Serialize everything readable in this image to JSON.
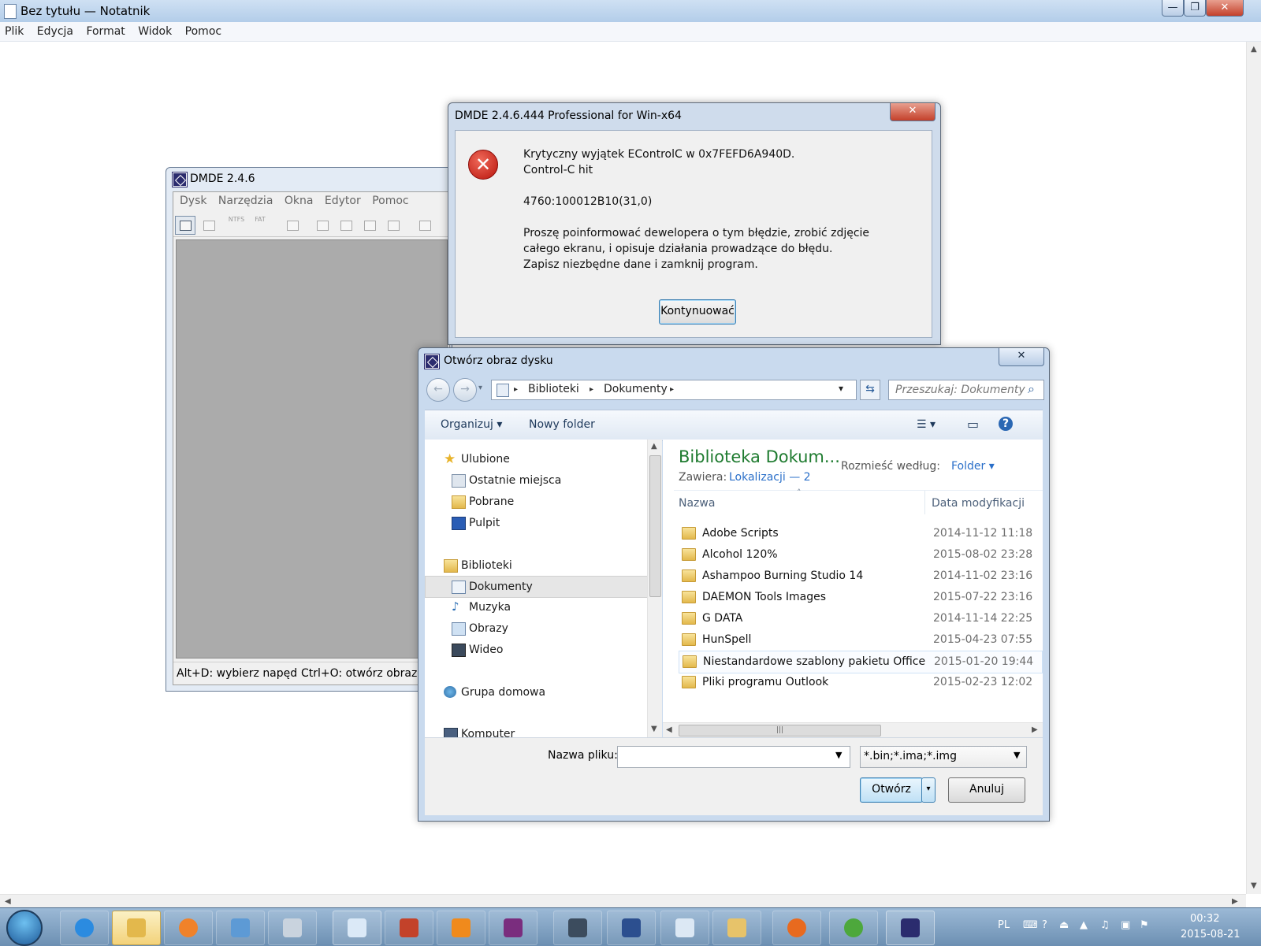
{
  "notepad": {
    "title": "Bez tytułu — Notatnik",
    "menu": [
      "Plik",
      "Edycja",
      "Format",
      "Widok",
      "Pomoc"
    ],
    "caption_buttons": {
      "minimize": "—",
      "maximize": "❐",
      "close": "✕"
    }
  },
  "dmde_main": {
    "title": "DMDE 2.4.6",
    "menu": [
      "Dysk",
      "Narzędzia",
      "Okna",
      "Edytor",
      "Pomoc"
    ],
    "toolbar_texts": {
      "ntfs": "NTFS",
      "fat": "FAT"
    },
    "status": {
      "left": "Alt+D: wybierz napęd",
      "right": "Ctrl+O: otwórz obraz"
    }
  },
  "error_dialog": {
    "title": "DMDE 2.4.6.444 Professional for Win-x64",
    "close": "✕",
    "icon": "✕",
    "lines": [
      "Krytyczny wyjątek EControlC w 0x7FEFD6A940D.",
      "Control-C hit",
      "4760:100012B10(31,0)",
      "Proszę poinformować dewelopera o tym błędzie, zrobić zdjęcie",
      "całego ekranu, i opisuje działania prowadzące do błędu.",
      "Zapisz niezbędne dane i zamknij program."
    ],
    "button": "Kontynuować"
  },
  "open_dialog": {
    "title": "Otwórz obraz dysku",
    "close": "✕",
    "nav": {
      "back": "←",
      "forward": "→",
      "dropdown": "▾"
    },
    "address": {
      "segments": [
        "Biblioteki",
        "Dokumenty"
      ],
      "separator": "▸",
      "dropdown": "▾",
      "refresh": "⇆"
    },
    "search": {
      "placeholder": "Przeszukaj: Dokumenty",
      "icon": "⌕"
    },
    "commands": {
      "organize": "Organizuj ▾",
      "new_folder": "Nowy folder",
      "view": "☰ ▾",
      "pane": "▭",
      "help": "?"
    },
    "nav_tree": [
      {
        "label": "Ulubione",
        "type": "group",
        "icon": "star-icon"
      },
      {
        "label": "Ostatnie miejsca",
        "type": "child",
        "icon": "recent-places-icon"
      },
      {
        "label": "Pobrane",
        "type": "child",
        "icon": "downloads-folder-icon"
      },
      {
        "label": "Pulpit",
        "type": "child",
        "icon": "desktop-icon"
      },
      {
        "label": "Biblioteki",
        "type": "group",
        "icon": "libraries-icon"
      },
      {
        "label": "Dokumenty",
        "type": "child",
        "icon": "documents-library-icon",
        "selected": true
      },
      {
        "label": "Muzyka",
        "type": "child",
        "icon": "music-library-icon"
      },
      {
        "label": "Obrazy",
        "type": "child",
        "icon": "pictures-library-icon"
      },
      {
        "label": "Wideo",
        "type": "child",
        "icon": "video-library-icon"
      },
      {
        "label": "Grupa domowa",
        "type": "group",
        "icon": "homegroup-icon"
      },
      {
        "label": "Komputer",
        "type": "group",
        "icon": "computer-icon"
      }
    ],
    "library": {
      "title": "Biblioteka Dokum...",
      "contains_label": "Zawiera:",
      "contains_value": "Lokalizacji — 2",
      "arrange_label": "Rozmieść według:",
      "arrange_value": "Folder ▾"
    },
    "columns": {
      "name": "Nazwa",
      "date": "Data modyfikacji",
      "sort_indicator": "˄"
    },
    "files": [
      {
        "name": "Adobe Scripts",
        "date": "2014-11-12 11:18"
      },
      {
        "name": "Alcohol 120%",
        "date": "2015-08-02 23:28"
      },
      {
        "name": "Ashampoo Burning Studio 14",
        "date": "2014-11-02 23:16"
      },
      {
        "name": "DAEMON Tools Images",
        "date": "2015-07-22 23:16"
      },
      {
        "name": "G DATA",
        "date": "2014-11-14 22:25"
      },
      {
        "name": "HunSpell",
        "date": "2015-04-23 07:55"
      },
      {
        "name": "Niestandardowe szablony pakietu Office",
        "date": "2015-01-20 19:44",
        "hover": true
      },
      {
        "name": "Pliki programu Outlook",
        "date": "2015-02-23 12:02"
      }
    ],
    "filename_label": "Nazwa pliku:",
    "filename_value": "",
    "filter_value": "*.bin;*.ima;*.img",
    "buttons": {
      "open": "Otwórz",
      "open_split": "▾",
      "cancel": "Anuluj"
    },
    "hscroll_grip": "|||"
  },
  "taskbar": {
    "apps": [
      "internet-explorer",
      "explorer",
      "media-player",
      "control-panel",
      "calculator",
      "notepad",
      "winrar-books",
      "vlc",
      "winrar",
      "network-monitor",
      "floppy-save",
      "photo-viewer",
      "paint",
      "firefox",
      "utorrent",
      "dmde"
    ],
    "language": "PL",
    "time": "00:32",
    "date": "2015-08-21"
  }
}
